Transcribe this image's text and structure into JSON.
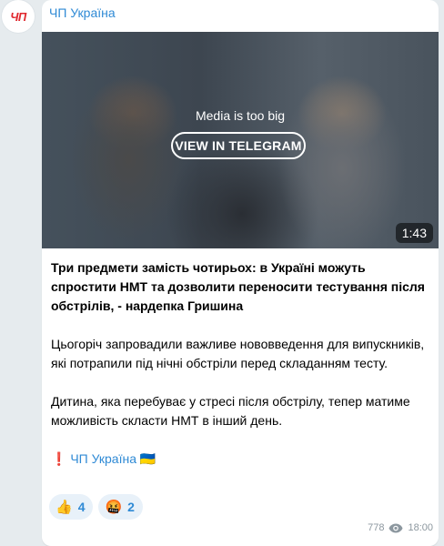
{
  "channel": {
    "avatar_text": "ЧП",
    "name": "ЧП Україна"
  },
  "media": {
    "message": "Media is too big",
    "button_label": "VIEW IN TELEGRAM",
    "duration": "1:43"
  },
  "post": {
    "headline": "Три предмети замість чотирьох: в Україні можуть спростити НМТ та дозволити переносити тестування після обстрілів, - нардепка Гришина",
    "paragraph1": "Цьогоріч запровадили важливе нововведення для випускників, які потрапили під нічні обстріли перед складанням тесту.",
    "paragraph2": "Дитина, яка перебуває у стресі після обстрілу, тепер матиме можливість скласти НМТ в інший день.",
    "signature_prefix": "❗️",
    "signature_link": "ЧП Україна",
    "signature_suffix": "🇺🇦"
  },
  "reactions": [
    {
      "emoji": "👍",
      "count": "4"
    },
    {
      "emoji": "🤬",
      "count": "2"
    }
  ],
  "meta": {
    "views": "778",
    "time": "18:00"
  },
  "colors": {
    "accent": "#2f8ad5",
    "background": "#e6ebee",
    "avatar_text": "#e0282e"
  }
}
